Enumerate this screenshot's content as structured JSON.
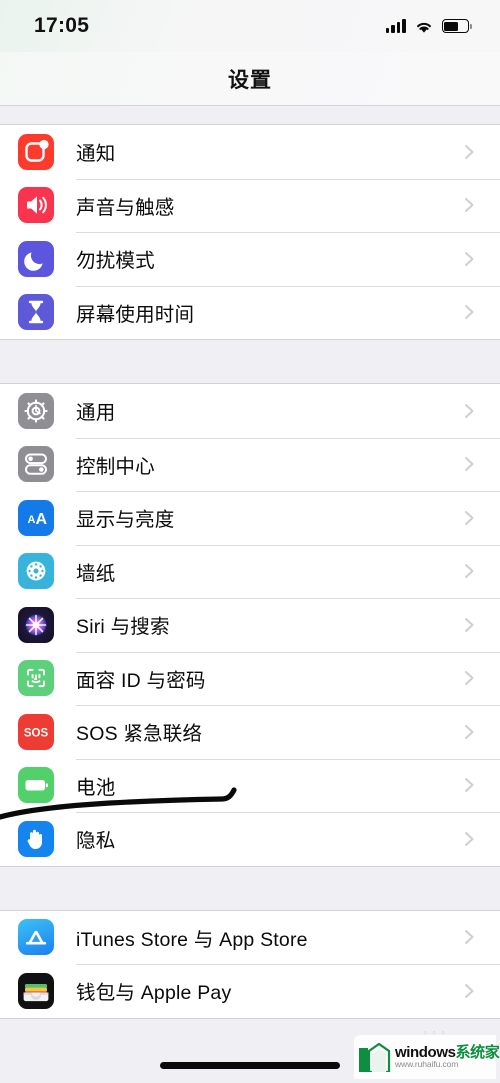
{
  "status_bar": {
    "time": "17:05",
    "signal_icon": "cellular-signal-icon",
    "wifi_icon": "wifi-icon",
    "battery_icon": "battery-icon",
    "battery_level_percent": 65
  },
  "nav": {
    "title": "设置"
  },
  "groups": [
    {
      "id": "group-system-alerts",
      "rows": [
        {
          "icon": "notifications-icon",
          "icon_class": "ic-notifications",
          "label": "通知"
        },
        {
          "icon": "sounds-haptics-icon",
          "icon_class": "ic-sounds",
          "label": "声音与触感"
        },
        {
          "icon": "do-not-disturb-icon",
          "icon_class": "ic-dnd",
          "label": "勿扰模式"
        },
        {
          "icon": "screen-time-icon",
          "icon_class": "ic-screentime",
          "label": "屏幕使用时间"
        }
      ]
    },
    {
      "id": "group-device-settings",
      "rows": [
        {
          "icon": "general-gear-icon",
          "icon_class": "ic-general",
          "label": "通用"
        },
        {
          "icon": "control-center-icon",
          "icon_class": "ic-control",
          "label": "控制中心"
        },
        {
          "icon": "display-brightness-icon",
          "icon_class": "ic-display",
          "label": "显示与亮度"
        },
        {
          "icon": "wallpaper-icon",
          "icon_class": "ic-wallpaper",
          "label": "墙纸"
        },
        {
          "icon": "siri-search-icon",
          "icon_class": "ic-siri",
          "label": "Siri 与搜索"
        },
        {
          "icon": "face-id-passcode-icon",
          "icon_class": "ic-faceid",
          "label": "面容 ID 与密码"
        },
        {
          "icon": "emergency-sos-icon",
          "icon_class": "ic-sos",
          "label": "SOS 紧急联络"
        },
        {
          "icon": "battery-settings-icon",
          "icon_class": "ic-battery",
          "label": "电池"
        },
        {
          "icon": "privacy-hand-icon",
          "icon_class": "ic-privacy",
          "label": "隐私"
        }
      ]
    },
    {
      "id": "group-store-accounts",
      "rows": [
        {
          "icon": "app-store-icon",
          "icon_class": "ic-appstore",
          "label": "iTunes Store 与 App Store"
        },
        {
          "icon": "wallet-apple-pay-icon",
          "icon_class": "ic-wallet",
          "label": "钱包与 Apple Pay"
        }
      ]
    }
  ],
  "annotation": {
    "type": "hand-drawn-underline",
    "target_row_label": "电池",
    "color": "#0a0a0a"
  },
  "home_indicator": {
    "visible": true
  },
  "watermark": {
    "brand": "windows",
    "brand_cn": "系统家园",
    "url": "www.ruhaifu.com",
    "logo_color": "#0c8f3f"
  },
  "colors": {
    "page_background": "#EFEFF4",
    "row_background": "#FFFFFF",
    "separator": "#DCDCDE",
    "chevron": "#C7C7CC",
    "label_text": "#0B0B0B"
  }
}
